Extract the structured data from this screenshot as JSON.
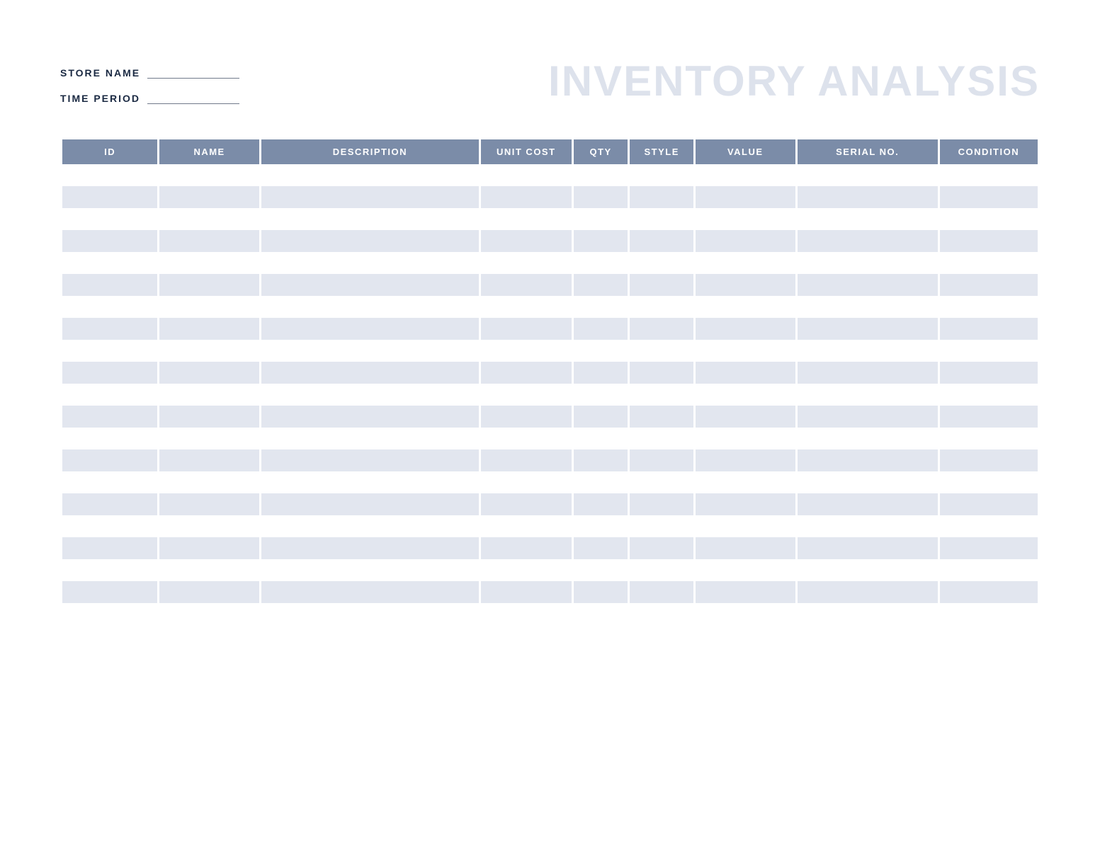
{
  "header": {
    "store_name_label": "STORE NAME",
    "time_period_label": "TIME PERIOD",
    "store_name_value": "",
    "time_period_value": "",
    "title": "INVENTORY ANALYSIS"
  },
  "table": {
    "columns": {
      "id": "ID",
      "name": "NAME",
      "description": "DESCRIPTION",
      "unit_cost": "UNIT COST",
      "qty": "QTY",
      "style": "STYLE",
      "value": "VALUE",
      "serial_no": "SERIAL NO.",
      "condition": "CONDITION"
    },
    "rows": [
      {
        "id": "",
        "name": "",
        "description": "",
        "unit_cost": "",
        "qty": "",
        "style": "",
        "value": "",
        "serial_no": "",
        "condition": ""
      },
      {
        "id": "",
        "name": "",
        "description": "",
        "unit_cost": "",
        "qty": "",
        "style": "",
        "value": "",
        "serial_no": "",
        "condition": ""
      },
      {
        "id": "",
        "name": "",
        "description": "",
        "unit_cost": "",
        "qty": "",
        "style": "",
        "value": "",
        "serial_no": "",
        "condition": ""
      },
      {
        "id": "",
        "name": "",
        "description": "",
        "unit_cost": "",
        "qty": "",
        "style": "",
        "value": "",
        "serial_no": "",
        "condition": ""
      },
      {
        "id": "",
        "name": "",
        "description": "",
        "unit_cost": "",
        "qty": "",
        "style": "",
        "value": "",
        "serial_no": "",
        "condition": ""
      },
      {
        "id": "",
        "name": "",
        "description": "",
        "unit_cost": "",
        "qty": "",
        "style": "",
        "value": "",
        "serial_no": "",
        "condition": ""
      },
      {
        "id": "",
        "name": "",
        "description": "",
        "unit_cost": "",
        "qty": "",
        "style": "",
        "value": "",
        "serial_no": "",
        "condition": ""
      },
      {
        "id": "",
        "name": "",
        "description": "",
        "unit_cost": "",
        "qty": "",
        "style": "",
        "value": "",
        "serial_no": "",
        "condition": ""
      },
      {
        "id": "",
        "name": "",
        "description": "",
        "unit_cost": "",
        "qty": "",
        "style": "",
        "value": "",
        "serial_no": "",
        "condition": ""
      },
      {
        "id": "",
        "name": "",
        "description": "",
        "unit_cost": "",
        "qty": "",
        "style": "",
        "value": "",
        "serial_no": "",
        "condition": ""
      },
      {
        "id": "",
        "name": "",
        "description": "",
        "unit_cost": "",
        "qty": "",
        "style": "",
        "value": "",
        "serial_no": "",
        "condition": ""
      },
      {
        "id": "",
        "name": "",
        "description": "",
        "unit_cost": "",
        "qty": "",
        "style": "",
        "value": "",
        "serial_no": "",
        "condition": ""
      },
      {
        "id": "",
        "name": "",
        "description": "",
        "unit_cost": "",
        "qty": "",
        "style": "",
        "value": "",
        "serial_no": "",
        "condition": ""
      },
      {
        "id": "",
        "name": "",
        "description": "",
        "unit_cost": "",
        "qty": "",
        "style": "",
        "value": "",
        "serial_no": "",
        "condition": ""
      },
      {
        "id": "",
        "name": "",
        "description": "",
        "unit_cost": "",
        "qty": "",
        "style": "",
        "value": "",
        "serial_no": "",
        "condition": ""
      },
      {
        "id": "",
        "name": "",
        "description": "",
        "unit_cost": "",
        "qty": "",
        "style": "",
        "value": "",
        "serial_no": "",
        "condition": ""
      },
      {
        "id": "",
        "name": "",
        "description": "",
        "unit_cost": "",
        "qty": "",
        "style": "",
        "value": "",
        "serial_no": "",
        "condition": ""
      },
      {
        "id": "",
        "name": "",
        "description": "",
        "unit_cost": "",
        "qty": "",
        "style": "",
        "value": "",
        "serial_no": "",
        "condition": ""
      },
      {
        "id": "",
        "name": "",
        "description": "",
        "unit_cost": "",
        "qty": "",
        "style": "",
        "value": "",
        "serial_no": "",
        "condition": ""
      },
      {
        "id": "",
        "name": "",
        "description": "",
        "unit_cost": "",
        "qty": "",
        "style": "",
        "value": "",
        "serial_no": "",
        "condition": ""
      },
      {
        "id": "",
        "name": "",
        "description": "",
        "unit_cost": "",
        "qty": "",
        "style": "",
        "value": "",
        "serial_no": "",
        "condition": ""
      }
    ]
  },
  "colors": {
    "header_bg": "#7b8ca8",
    "row_alt_bg": "#e2e6ef",
    "title_color": "#dde2ec",
    "label_color": "#1a2942"
  }
}
